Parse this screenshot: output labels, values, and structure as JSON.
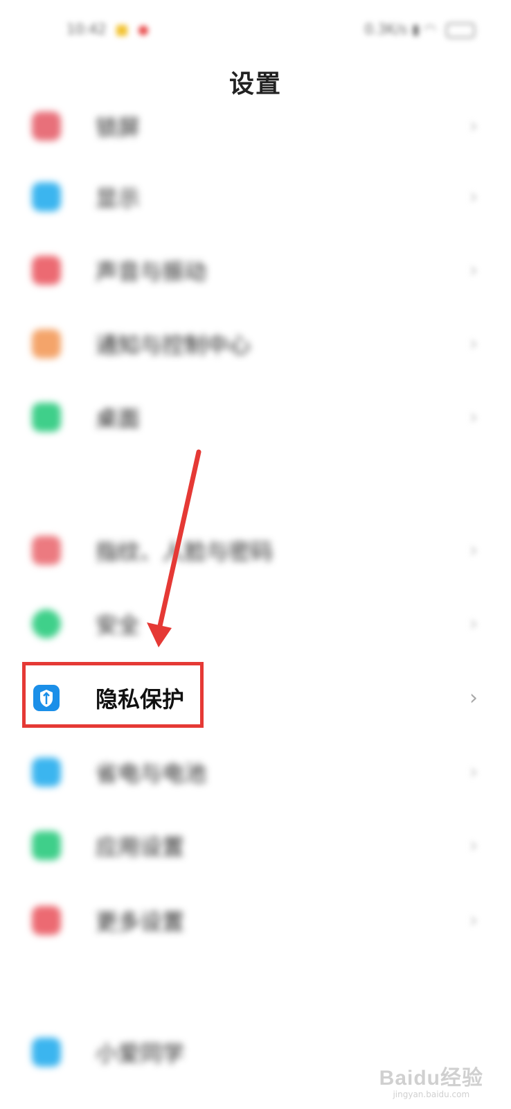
{
  "status_bar": {
    "time": "10:42",
    "right_text": "0.3K/s"
  },
  "header": {
    "title": "设置"
  },
  "settings_items": [
    {
      "label": "锁屏",
      "icon": "lock-screen-icon",
      "color": "#e8707a"
    },
    {
      "label": "显示",
      "icon": "display-icon",
      "color": "#3bb5ef"
    },
    {
      "label": "声音与振动",
      "icon": "sound-icon",
      "color": "#ec6a72"
    },
    {
      "label": "通知与控制中心",
      "icon": "notification-icon",
      "color": "#f4a46a"
    },
    {
      "label": "桌面",
      "icon": "home-screen-icon",
      "color": "#3fcf8a"
    },
    {
      "label": "指纹、人脸与密码",
      "icon": "fingerprint-icon",
      "color": "#ec7a80"
    },
    {
      "label": "安全",
      "icon": "security-icon",
      "color": "#3fd08a"
    },
    {
      "label": "隐私保护",
      "icon": "privacy-shield-icon",
      "color": "#1b8fe8"
    },
    {
      "label": "省电与电池",
      "icon": "battery-icon",
      "color": "#3bb5ef"
    },
    {
      "label": "应用设置",
      "icon": "app-settings-icon",
      "color": "#3fcf8a"
    },
    {
      "label": "更多设置",
      "icon": "more-settings-icon",
      "color": "#ec6a72"
    },
    {
      "label": "小爱同学",
      "icon": "assistant-icon",
      "color": "#3bb5ef"
    }
  ],
  "annotation": {
    "highlight_color": "#e53935",
    "arrow_color": "#e53935"
  },
  "watermark": {
    "main": "Baidu经验",
    "sub": "jingyan.baidu.com"
  }
}
